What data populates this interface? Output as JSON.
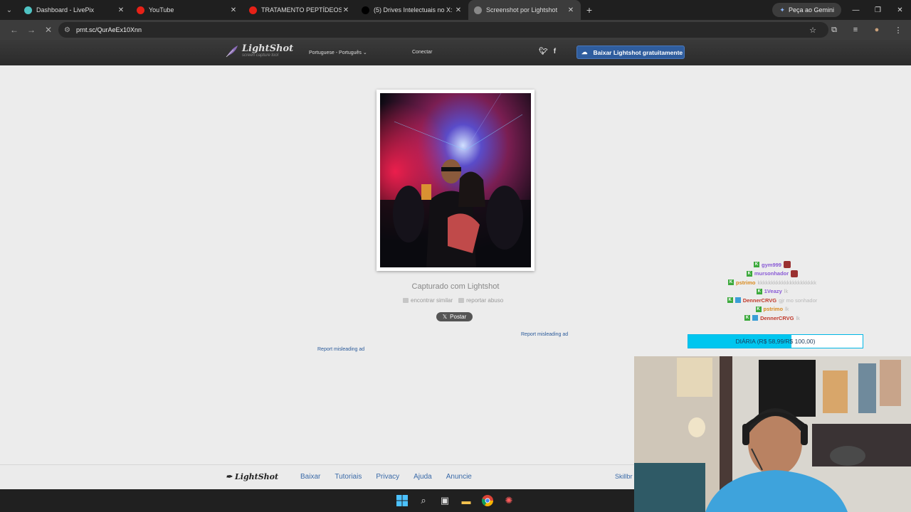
{
  "browser": {
    "tabs": [
      {
        "title": "Dashboard - LivePix",
        "icon": "livepix-icon",
        "color": "#4fc3c3"
      },
      {
        "title": "YouTube",
        "icon": "youtube-icon",
        "color": "#e62117"
      },
      {
        "title": "TRATAMENTO PEPTÍDEOS - ÚM",
        "icon": "youtube-icon",
        "color": "#e62117"
      },
      {
        "title": "(5) Drives Intelectuais no X: \"Ho",
        "icon": "x-icon",
        "color": "#000000"
      },
      {
        "title": "Screenshot por Lightshot",
        "icon": "lightshot-icon",
        "color": "#888888"
      }
    ],
    "gemini_label": "Peça ao Gemini",
    "url": "prnt.sc/QurAeEx10Xnn"
  },
  "lightshot": {
    "logo": "LightShot",
    "tagline": "screen capture tool",
    "language": "Portuguese - Português",
    "connect": "Conectar",
    "download": "Baixar Lightshot gratuitamente",
    "caption": "Capturado com Lightshot",
    "find_similar": "encontrar similar",
    "report_abuse": "reportar abuso",
    "post": "Postar",
    "report_ad_1": "Report misleading ad",
    "report_ad_2": "Report misleading ad",
    "footer_logo": "LightShot",
    "footer_links": [
      "Baixar",
      "Tutoriais",
      "Privacy",
      "Ajuda",
      "Anuncie"
    ],
    "footer_partner": "Skillbr"
  },
  "stream": {
    "chat": [
      {
        "user": "gym999",
        "color": "#8a5bd6",
        "msg": "",
        "badge2": false
      },
      {
        "user": "mursonhador",
        "color": "#8a5bd6",
        "msg": "",
        "badge2": false
      },
      {
        "user": "pstrimo",
        "color": "#d98a1e",
        "msg": "kkkkkkkkkkkkkkkkkkkkkk",
        "badge2": false
      },
      {
        "user": "1Veazy",
        "color": "#8a5bd6",
        "msg": "lk",
        "badge2": false
      },
      {
        "user": "DennerCRVG",
        "color": "#c0392b",
        "msg": "gjr mo sonhador",
        "badge2": true
      },
      {
        "user": "pstrimo",
        "color": "#d98a1e",
        "msg": "lk",
        "badge2": false
      },
      {
        "user": "DennerCRVG",
        "color": "#c0392b",
        "msg": "lk",
        "badge2": true
      }
    ],
    "goal_text": "DIÁRIA (R$ 58,99/R$ 100,00)",
    "goal_progress": 0.5899
  }
}
